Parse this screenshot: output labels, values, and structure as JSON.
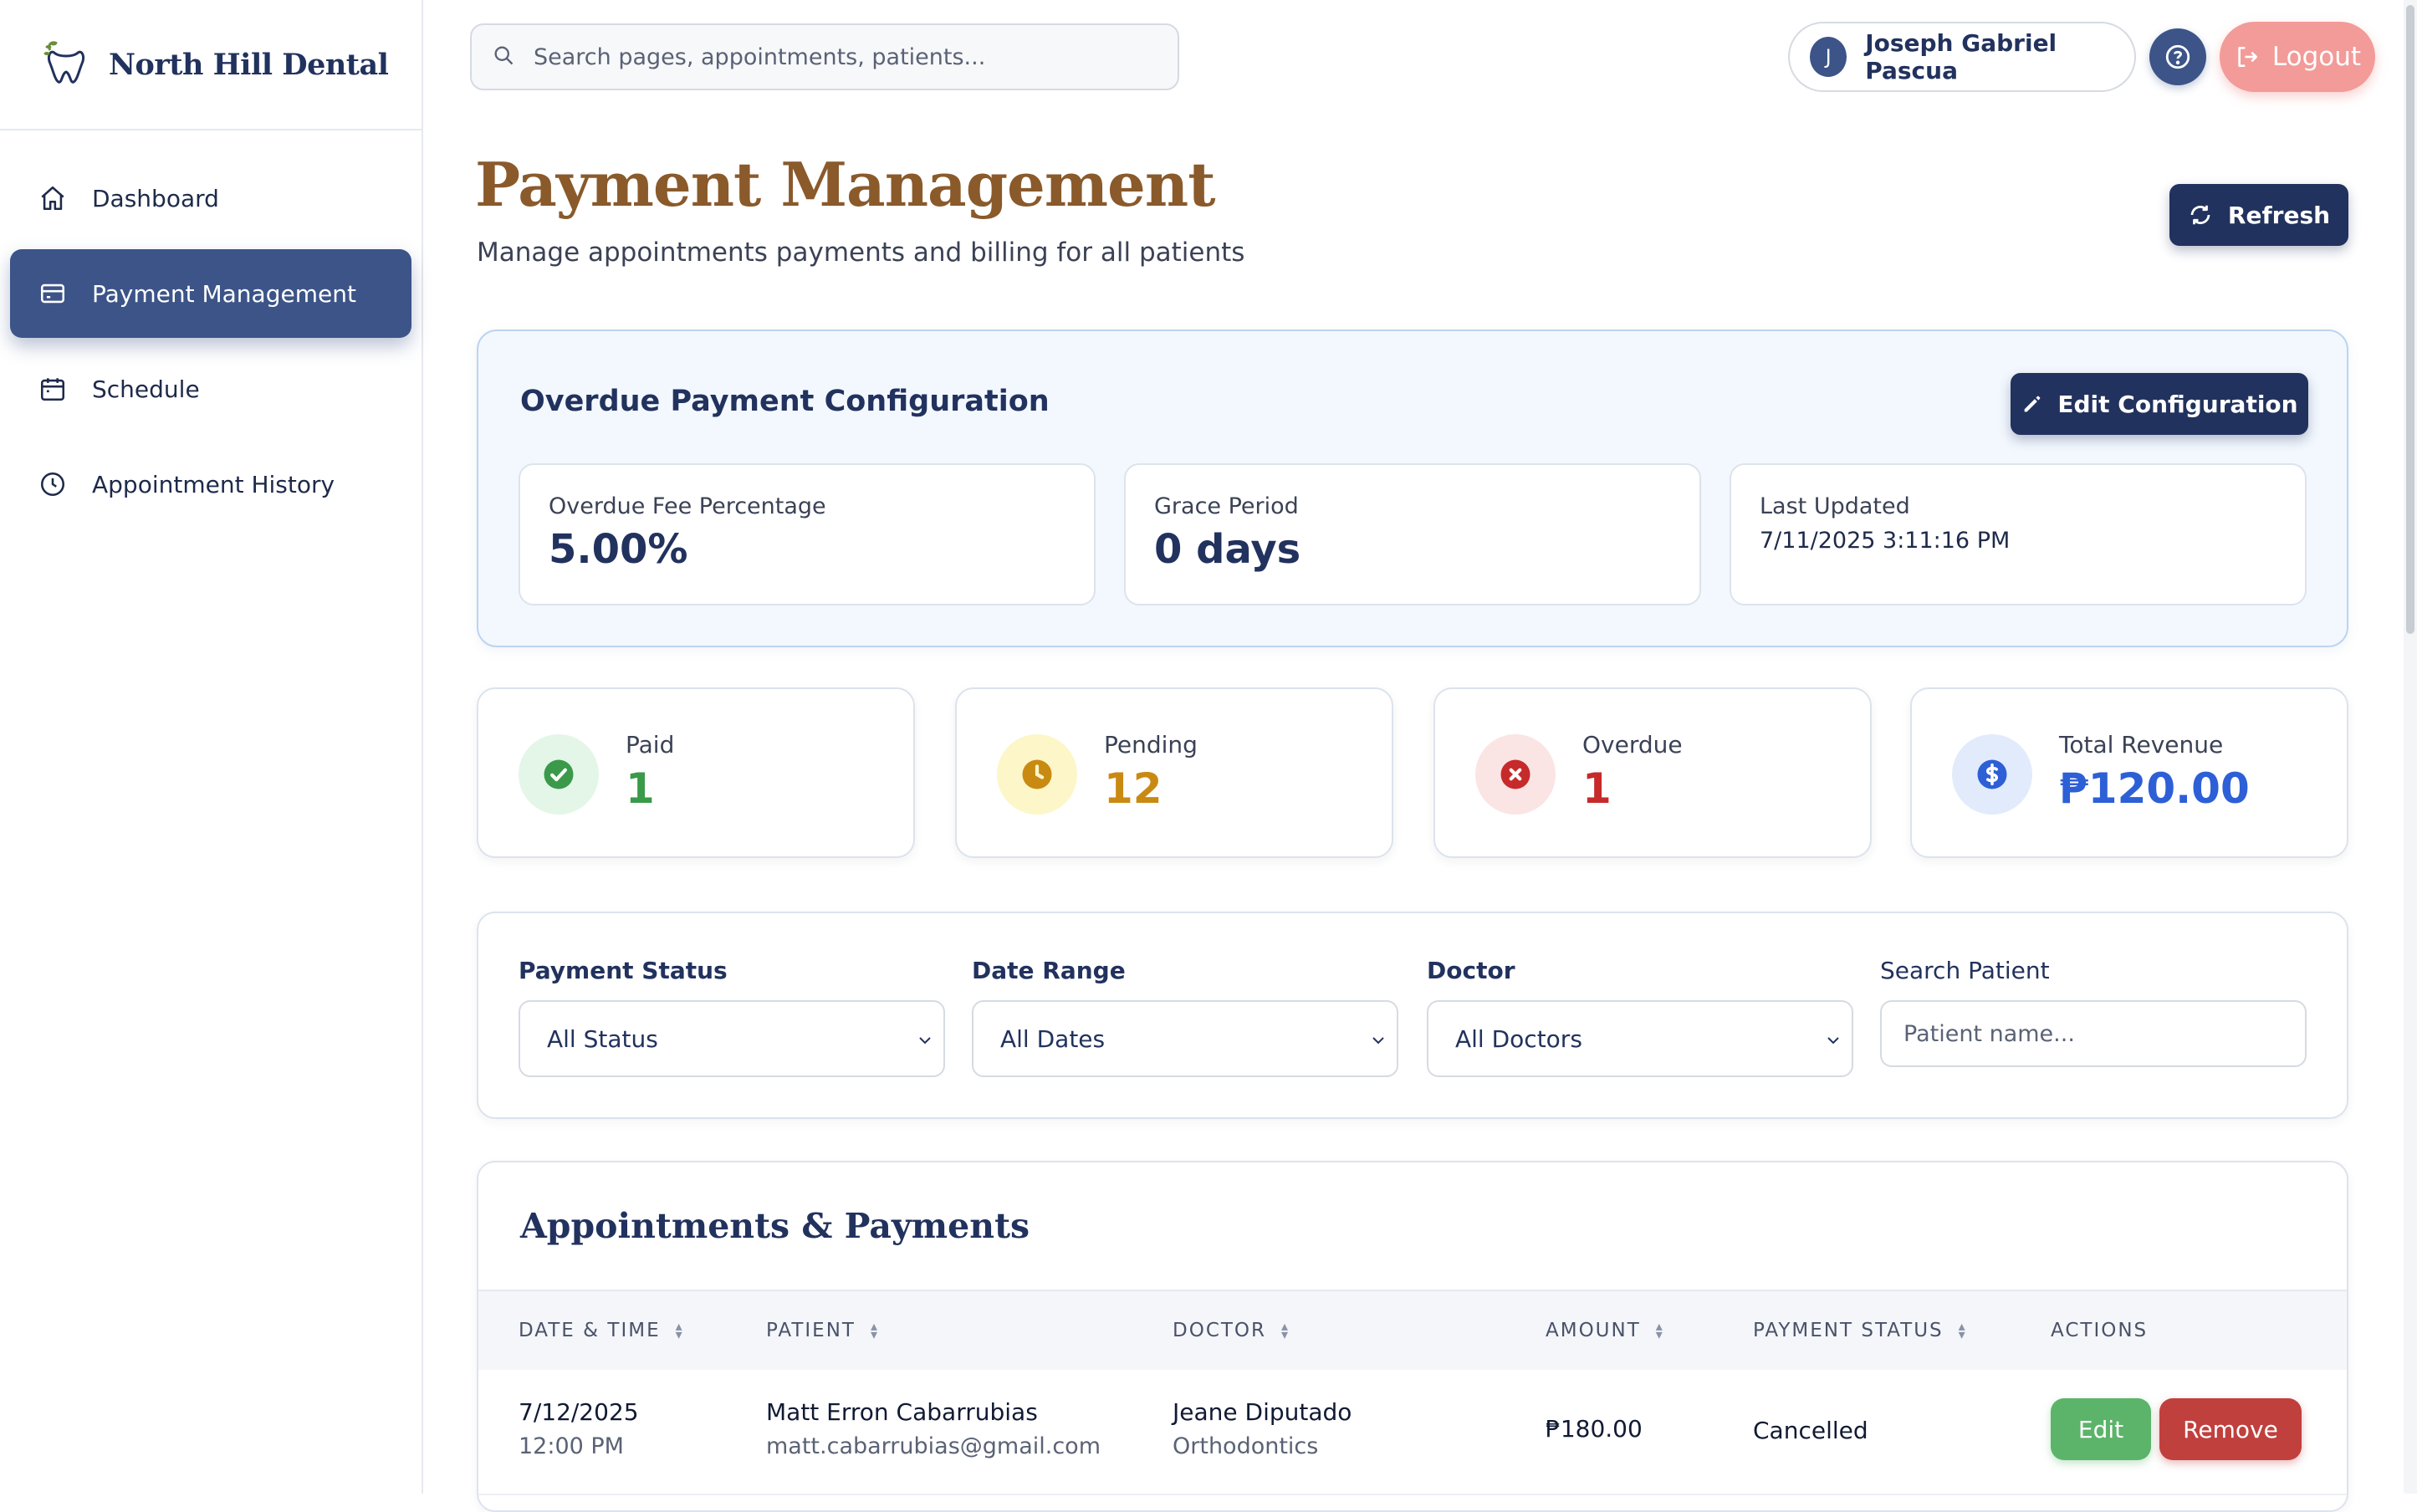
{
  "brand": {
    "name": "North Hill Dental"
  },
  "sidebar": {
    "items": [
      {
        "label": "Dashboard",
        "icon": "home-icon",
        "active": false
      },
      {
        "label": "Payment Management",
        "icon": "credit-card-icon",
        "active": true
      },
      {
        "label": "Schedule",
        "icon": "calendar-icon",
        "active": false
      },
      {
        "label": "Appointment History",
        "icon": "clock-icon",
        "active": false
      }
    ]
  },
  "topbar": {
    "search_placeholder": "Search pages, appointments, patients...",
    "user_initial": "J",
    "user_name": "Joseph Gabriel Pascua",
    "logout_label": "Logout"
  },
  "page": {
    "title": "Payment Management",
    "subtitle": "Manage appointments payments and billing for all patients",
    "refresh_label": "Refresh"
  },
  "config": {
    "title": "Overdue Payment Configuration",
    "edit_label": "Edit Configuration",
    "fee_label": "Overdue Fee Percentage",
    "fee_value": "5.00%",
    "grace_label": "Grace Period",
    "grace_value": "0 days",
    "updated_label": "Last Updated",
    "updated_value": "7/11/2025 3:11:16 PM"
  },
  "stats": {
    "paid": {
      "label": "Paid",
      "value": "1",
      "color": "#3a9a4a"
    },
    "pending": {
      "label": "Pending",
      "value": "12",
      "color": "#c98a12"
    },
    "overdue": {
      "label": "Overdue",
      "value": "1",
      "color": "#c62a2a"
    },
    "revenue": {
      "label": "Total Revenue",
      "value": "₱120.00",
      "color": "#2d5fd6"
    }
  },
  "filters": {
    "status_label": "Payment Status",
    "status_value": "All Status",
    "date_label": "Date Range",
    "date_value": "All Dates",
    "doctor_label": "Doctor",
    "doctor_value": "All Doctors",
    "patient_label": "Search Patient",
    "patient_placeholder": "Patient name..."
  },
  "table": {
    "title": "Appointments & Payments",
    "columns": [
      "DATE & TIME",
      "PATIENT",
      "DOCTOR",
      "AMOUNT",
      "PAYMENT STATUS",
      "ACTIONS"
    ],
    "rows": [
      {
        "date": "7/12/2025",
        "time": "12:00 PM",
        "patient": "Matt Erron Cabarrubias",
        "email": "matt.cabarrubias@gmail.com",
        "doctor": "Jeane Diputado",
        "specialty": "Orthodontics",
        "amount": "₱180.00",
        "status": "Cancelled",
        "edit_label": "Edit",
        "remove_label": "Remove"
      }
    ]
  },
  "colors": {
    "accent": "#3c5488",
    "navy": "#22325e",
    "title_brown": "#8a5a2b",
    "logout": "#f29b98"
  }
}
